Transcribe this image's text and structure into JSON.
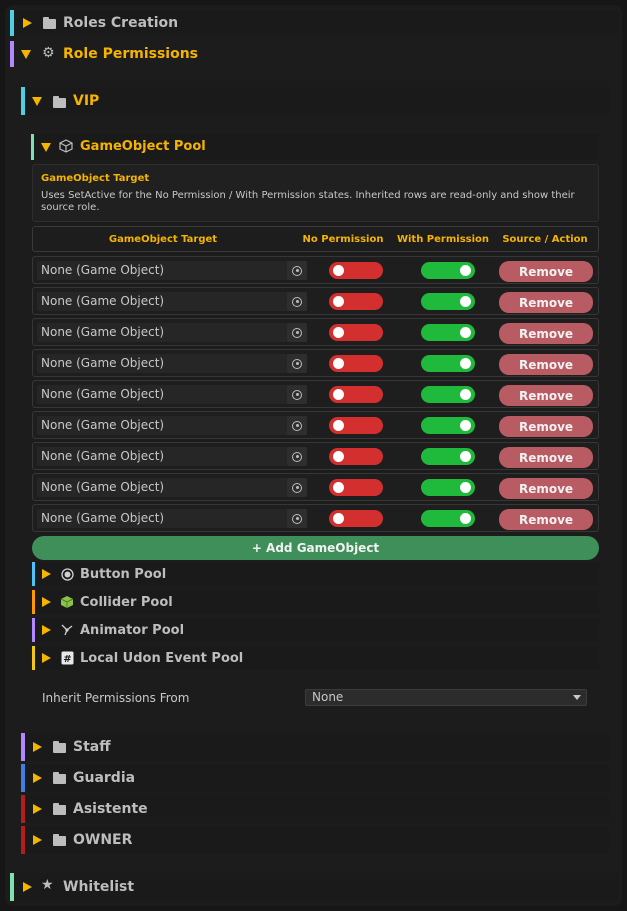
{
  "sections": {
    "roles_creation": "Roles Creation",
    "role_permissions": "Role Permissions",
    "whitelist": "Whitelist"
  },
  "roles": {
    "vip": "VIP",
    "others": [
      "Staff",
      "Guardia",
      "Asistente",
      "OWNER"
    ]
  },
  "gameobject_pool": {
    "title": "GameObject Pool",
    "note_title": "GameObject Target",
    "note_text": "Uses SetActive for the No Permission / With Permission states. Inherited rows are read-only and show their source role.",
    "columns": [
      "GameObject Target",
      "No Permission",
      "With Permission",
      "Source / Action"
    ],
    "rows": [
      {
        "target": "None (Game Object)",
        "no_permission": false,
        "with_permission": true,
        "action": "Remove"
      },
      {
        "target": "None (Game Object)",
        "no_permission": false,
        "with_permission": true,
        "action": "Remove"
      },
      {
        "target": "None (Game Object)",
        "no_permission": false,
        "with_permission": true,
        "action": "Remove"
      },
      {
        "target": "None (Game Object)",
        "no_permission": false,
        "with_permission": true,
        "action": "Remove"
      },
      {
        "target": "None (Game Object)",
        "no_permission": false,
        "with_permission": true,
        "action": "Remove"
      },
      {
        "target": "None (Game Object)",
        "no_permission": false,
        "with_permission": true,
        "action": "Remove"
      },
      {
        "target": "None (Game Object)",
        "no_permission": false,
        "with_permission": true,
        "action": "Remove"
      },
      {
        "target": "None (Game Object)",
        "no_permission": false,
        "with_permission": true,
        "action": "Remove"
      },
      {
        "target": "None (Game Object)",
        "no_permission": false,
        "with_permission": true,
        "action": "Remove"
      }
    ],
    "add_label": "+ Add GameObject"
  },
  "pools": [
    {
      "label": "Button Pool",
      "icon": "radio-button-icon",
      "color": "#4fc3f7"
    },
    {
      "label": "Collider Pool",
      "icon": "cube-icon",
      "color": "#ff9800"
    },
    {
      "label": "Animator Pool",
      "icon": "animator-icon",
      "color": "#b388ff"
    },
    {
      "label": "Local Udon Event Pool",
      "icon": "script-icon",
      "color": "#f5c518"
    }
  ],
  "inherit": {
    "label": "Inherit Permissions From",
    "value": "None"
  },
  "colors": {
    "accent": "#f5b400",
    "toggle_off": "#d32f2f",
    "toggle_on": "#1fba3c",
    "remove": "#b85b62",
    "add": "#3f8f5b"
  }
}
